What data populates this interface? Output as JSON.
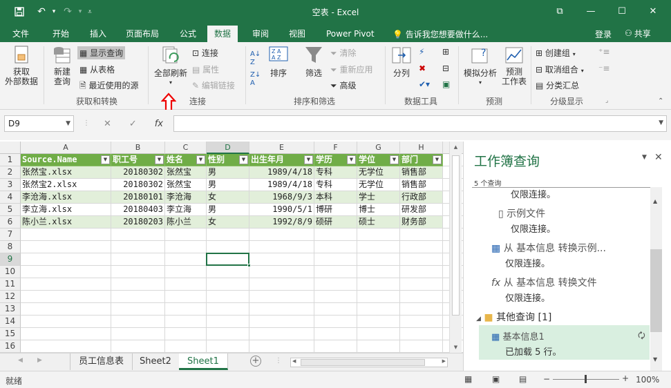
{
  "app": {
    "window_title": "空表 - Excel",
    "window_buttons": [
      "⧉",
      "—",
      "☐",
      "✕"
    ]
  },
  "tabs": [
    "文件",
    "开始",
    "插入",
    "页面布局",
    "公式",
    "数据",
    "审阅",
    "视图",
    "Power Pivot"
  ],
  "active_tab": "数据",
  "tell_me": "告诉我您想要做什么...",
  "login": "登录",
  "share": "共享",
  "ribbon": {
    "get_external": "获取\n外部数据",
    "new_query": "新建\n查询",
    "show_query": "显示查询",
    "from_table": "从表格",
    "recent_sources": "最近使用的源",
    "group_get_transform": "获取和转换",
    "refresh_all": "全部刷新",
    "connections": "连接",
    "properties": "属性",
    "edit_links": "编辑链接",
    "group_connections": "连接",
    "sort": "排序",
    "filter": "筛选",
    "clear": "清除",
    "reapply": "重新应用",
    "advanced": "高级",
    "group_sort_filter": "排序和筛选",
    "text_to_columns": "分列",
    "group_data_tools": "数据工具",
    "what_if": "模拟分析",
    "forecast_sheet": "预测\n工作表",
    "group_forecast": "预测",
    "group_btn": "创建组",
    "ungroup_btn": "取消组合",
    "subtotal": "分类汇总",
    "group_outline": "分级显示",
    "red_arrow_icon": "up-arrow-red"
  },
  "formula_bar": {
    "name_box": "D9",
    "formula": ""
  },
  "grid": {
    "columns": [
      "A",
      "B",
      "C",
      "D",
      "E",
      "F",
      "G",
      "H",
      "I"
    ],
    "selected_col": "D",
    "selected_row": "9",
    "rows": [
      "1",
      "2",
      "3",
      "4",
      "5",
      "6",
      "7",
      "8",
      "9",
      "10",
      "11",
      "12",
      "13",
      "14",
      "15",
      "16"
    ],
    "headers": [
      "Source.Name",
      "职工号",
      "姓名",
      "性别",
      "出生年月",
      "学历",
      "学位",
      "部门"
    ],
    "data": [
      [
        "张然宝.xlsx",
        "20180302",
        "张然宝",
        "男",
        "1989/4/18",
        "专科",
        "无学位",
        "销售部"
      ],
      [
        "张然宝2.xlsx",
        "20180302",
        "张然宝",
        "男",
        "1989/4/18",
        "专科",
        "无学位",
        "销售部"
      ],
      [
        "李沧海.xlsx",
        "20180101",
        "李沧海",
        "女",
        "1968/9/3",
        "本科",
        "学士",
        "行政部"
      ],
      [
        "李立海.xlsx",
        "20180403",
        "李立海",
        "男",
        "1990/5/1",
        "博研",
        "博士",
        "研发部"
      ],
      [
        "陈小兰.xlsx",
        "20180203",
        "陈小兰",
        "女",
        "1992/8/9",
        "硕研",
        "硕士",
        "财务部"
      ]
    ]
  },
  "sheets": [
    "员工信息表",
    "Sheet2",
    "Sheet1"
  ],
  "active_sheet": "Sheet1",
  "status": {
    "ready": "就绪",
    "zoom": "100%"
  },
  "query_pane": {
    "title": "工作簿查询",
    "count": "5 个查询",
    "items": [
      {
        "title": "",
        "sub": "仅限连接。"
      },
      {
        "title": "示例文件",
        "sub": "仅限连接。"
      },
      {
        "title": "从 基本信息 转换示例...",
        "sub": "仅限连接。"
      },
      {
        "title": "从 基本信息 转换文件",
        "sub": "仅限连接。"
      }
    ],
    "folder": "其他查询 [1]",
    "selected": {
      "title": "基本信息1",
      "sub": "已加载 5 行。"
    }
  }
}
